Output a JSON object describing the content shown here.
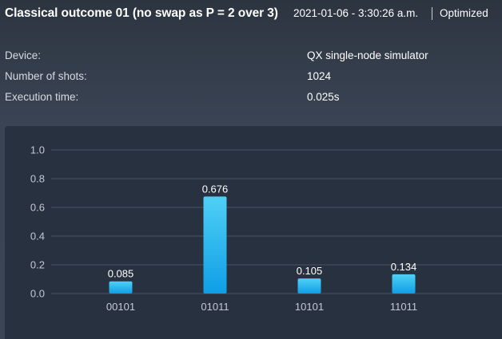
{
  "header": {
    "title": "Classical outcome 01 (no swap as P = 2 over 3)",
    "timestamp": "2021-01-06 - 3:30:26 a.m.",
    "mode": "Optimized"
  },
  "details": [
    {
      "label": "Device:",
      "value": "QX single-node simulator"
    },
    {
      "label": "Number of shots:",
      "value": "1024"
    },
    {
      "label": "Execution time:",
      "value": "0.025s"
    }
  ],
  "colors": {
    "bar_top": "#4fd0f5",
    "bar_bottom": "#0f9ee6",
    "panel": "#283140"
  },
  "chart_data": {
    "type": "bar",
    "categories": [
      "00101",
      "01011",
      "10101",
      "11011"
    ],
    "values": [
      0.085,
      0.676,
      0.105,
      0.134
    ],
    "value_labels": [
      "0.085",
      "0.676",
      "0.105",
      "0.134"
    ],
    "ylim": [
      0,
      1.0
    ],
    "yticks": [
      0.0,
      0.2,
      0.4,
      0.6,
      0.8,
      1.0
    ],
    "ytick_labels": [
      "0.0",
      "0.2",
      "0.4",
      "0.6",
      "0.8",
      "1.0"
    ],
    "grid": true,
    "title": "",
    "xlabel": "",
    "ylabel": ""
  }
}
